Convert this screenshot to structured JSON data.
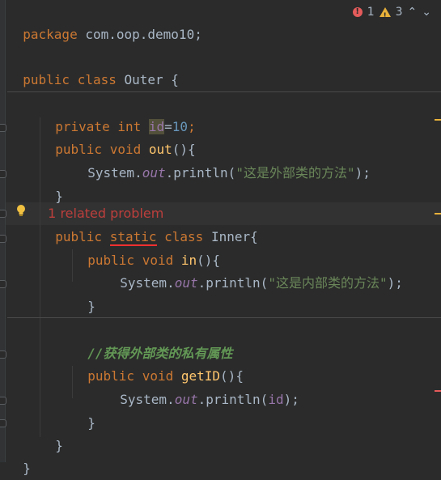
{
  "editor": {
    "status": {
      "error_count": "1",
      "warning_count": "3",
      "chevron_up": "⌃",
      "chevron_down": "⌄"
    },
    "lines": {
      "l1": {
        "kw": "package",
        "rest": " com.oop.demo10;"
      },
      "l3": {
        "kw1": "public",
        "kw2": "class",
        "rest": " Outer {"
      },
      "l5": {
        "kw1": "private",
        "kw2": "int",
        "field": "id",
        "eq": "=",
        "num": "10",
        "semi": ";"
      },
      "l6": {
        "kw1": "public",
        "kw2": "void",
        "method": "out",
        "rest": "(){"
      },
      "l7": {
        "obj": "System.",
        "field": "out",
        "call": ".println(",
        "str": "\"这是外部类的方法\"",
        "end": ");"
      },
      "l8": {
        "text": "}"
      },
      "related": "1 related problem",
      "l9": {
        "kw1": "public",
        "kw2": "static",
        "kw3": "class",
        "rest": " Inner{"
      },
      "l10": {
        "kw1": "public",
        "kw2": "void",
        "method": "in",
        "rest": "(){"
      },
      "l11": {
        "obj": "System.",
        "field": "out",
        "call": ".println(",
        "str": "\"这是内部类的方法\"",
        "end": ");"
      },
      "l12": {
        "text": "}"
      },
      "l14": {
        "comment": "//获得外部类的私有属性"
      },
      "l15": {
        "kw1": "public",
        "kw2": "void",
        "method": "getID",
        "rest": "(){"
      },
      "l16": {
        "obj": "System.",
        "field": "out",
        "call": ".println(",
        "arg": "id",
        "end": ");"
      },
      "l17": {
        "text": "}"
      },
      "l18": {
        "text": "}"
      },
      "l19": {
        "text": "}"
      }
    },
    "colors": {
      "background": "#2b2b2b",
      "keyword": "#cc7832",
      "string": "#6a8759",
      "number": "#6897bb",
      "field": "#9876aa",
      "method": "#ffc66d",
      "comment": "#629755",
      "error": "#bc3f3c"
    }
  }
}
